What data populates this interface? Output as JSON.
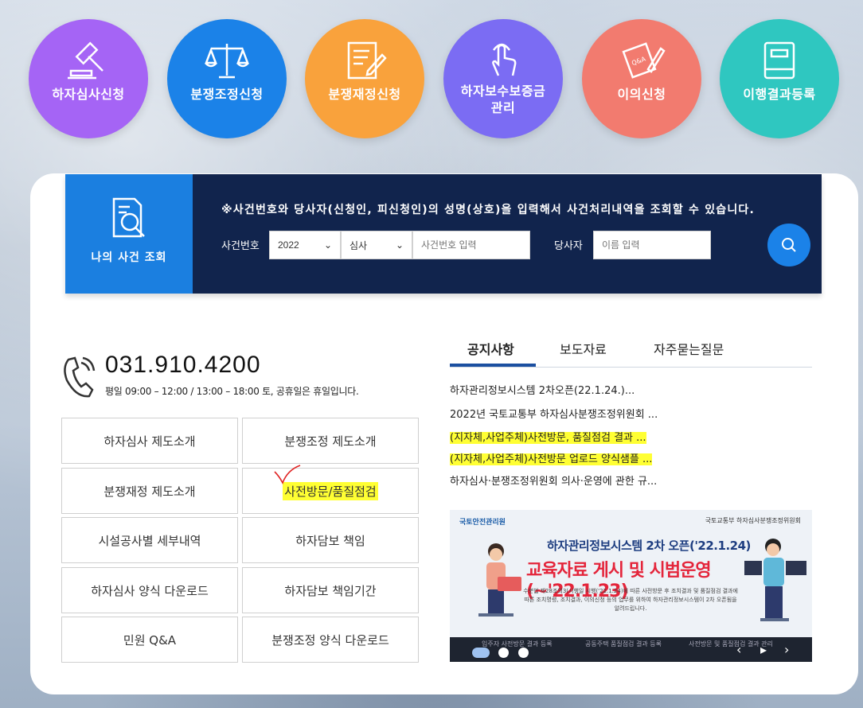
{
  "quick_links": [
    {
      "label": "하자심사신청",
      "icon": "gavel-icon",
      "color": "#a564f5"
    },
    {
      "label": "분쟁조정신청",
      "icon": "scale-icon",
      "color": "#1b82e8"
    },
    {
      "label": "분쟁재정신청",
      "icon": "document-pen-icon",
      "color": "#f9a23c"
    },
    {
      "label": "하자보수보증금\n관리",
      "icon": "touch-hand-icon",
      "color": "#7b6cf3"
    },
    {
      "label": "이의신청",
      "icon": "qna-note-icon",
      "color": "#f27b6f"
    },
    {
      "label": "이행결과등록",
      "icon": "book-icon",
      "color": "#2fc7c0"
    }
  ],
  "search": {
    "tab_label": "나의 사건 조회",
    "notice": "※사건번호와 당사자(신청인, 피신청인)의 성명(상호)을 입력해서 사건처리내역을 조회할 수 있습니다.",
    "case_label": "사건번호",
    "year_value": "2022",
    "type_value": "심사",
    "case_placeholder": "사건번호 입력",
    "party_label": "당사자",
    "party_placeholder": "이름 입력"
  },
  "contact": {
    "phone": "031.910.4200",
    "hours": "평일 09:00 – 12:00 / 13:00 – 18:00 토, 공휴일은 휴일입니다."
  },
  "menu": [
    "하자심사 제도소개",
    "분쟁조정 제도소개",
    "분쟁재정 제도소개",
    "사전방문/품질점검",
    "시설공사별 세부내역",
    "하자담보 책임",
    "하자심사 양식 다운로드",
    "하자담보 책임기간",
    "민원 Q&A",
    "분쟁조정 양식 다운로드"
  ],
  "tabs": [
    "공지사항",
    "보도자료",
    "자주묻는질문"
  ],
  "news": [
    "하자관리정보시스템 2차오픈(22.1.24.)...",
    "2022년 국토교통부 하자심사분쟁조정위원회 ...",
    "(지자체,사업주체)사전방문, 품질점검 결과 ...",
    "(지자체,사업주체)사전방문 업로드 양식샘플 ...",
    "하자심사·분쟁조정위원회 의사·운영에 관한 규..."
  ],
  "banner": {
    "logo_left": "국토안전관리원",
    "logo_right": "국토교통부 하자심사분쟁조정위원회",
    "title1": "하자관리정보시스템 2차 오픈('22.1.24)",
    "title2": "교육자료 게시 및 시범운영(~'22.1.23)",
    "desc": "수분법 제28조의3(시행일 시행('22.1.24)에 따른 사전방문 후 조치결과 및 품질점검 결과에 따른 조치명령, 조치결과, 이의신청 등의 업무를 위하여 하자관리정보시스템이 2차 오픈됨을 알려드립니다.",
    "caption1": "입주자 사전방문 결과 등록",
    "caption2": "공동주택 품질점검 결과 등록",
    "caption3": "사전방문 및 품질점검 결과 관리"
  },
  "colors": {
    "navy": "#11244d",
    "blue": "#1b82e8",
    "highlight": "#ffff33"
  }
}
